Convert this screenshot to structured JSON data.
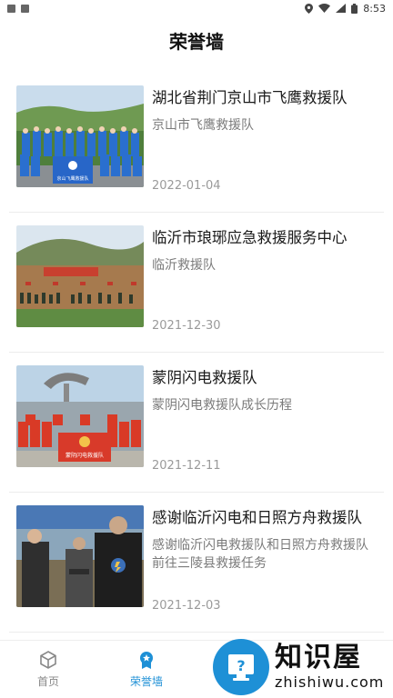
{
  "status_bar": {
    "time": "8:53"
  },
  "page_title": "荣誉墙",
  "items": [
    {
      "title": "湖北省荆门京山市飞鹰救援队",
      "subtitle": "京山市飞鹰救援队",
      "date": "2022-01-04",
      "banner": "京山飞鹰救援队"
    },
    {
      "title": "临沂市琅琊应急救援服务中心",
      "subtitle": "临沂救援队",
      "date": "2021-12-30"
    },
    {
      "title": "蒙阴闪电救援队",
      "subtitle": "蒙阴闪电救援队成长历程",
      "date": "2021-12-11",
      "banner": "蒙阴闪电救援队"
    },
    {
      "title": "感谢临沂闪电和日照方舟救援队",
      "subtitle": "感谢临沂闪电救援队和日照方舟救援队前往三陵县救援任务",
      "date": "2021-12-03"
    }
  ],
  "tabs": [
    {
      "label": "首页",
      "icon": "cube-icon",
      "active": false
    },
    {
      "label": "荣誉墙",
      "icon": "medal-icon",
      "active": true
    }
  ],
  "watermark": {
    "cn": "知识屋",
    "en": "zhishiwu.com",
    "badge": "?"
  },
  "colors": {
    "accent": "#1e90d6",
    "inactive": "#888888"
  }
}
